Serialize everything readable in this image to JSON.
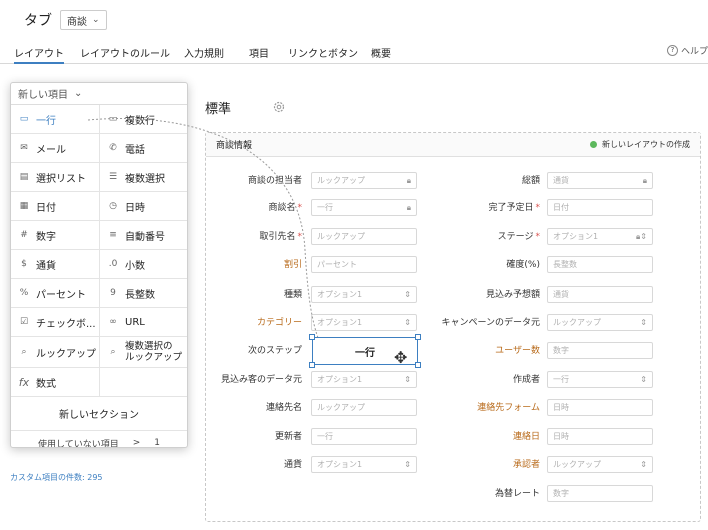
{
  "header": {
    "title": "タブ",
    "tab_value": "商談"
  },
  "nav": {
    "items": [
      "レイアウト",
      "レイアウトのルール",
      "入力規則",
      "項目",
      "リンクとボタン",
      "概要"
    ],
    "help": "ヘルプ"
  },
  "palette": {
    "title": "新しい項目",
    "items": [
      {
        "icon": "single-line-icon",
        "label": "一行"
      },
      {
        "icon": "multi-line-icon",
        "label": "複数行"
      },
      {
        "icon": "mail-icon",
        "label": "メール"
      },
      {
        "icon": "phone-icon",
        "label": "電話"
      },
      {
        "icon": "picklist-icon",
        "label": "選択リスト"
      },
      {
        "icon": "multi-select-icon",
        "label": "複数選択"
      },
      {
        "icon": "calendar-icon",
        "label": "日付"
      },
      {
        "icon": "datetime-icon",
        "label": "日時"
      },
      {
        "icon": "number-icon",
        "label": "数字"
      },
      {
        "icon": "autonumber-icon",
        "label": "自動番号"
      },
      {
        "icon": "currency-icon",
        "label": "通貨"
      },
      {
        "icon": "decimal-icon",
        "label": "小数"
      },
      {
        "icon": "percent-icon",
        "label": "パーセント"
      },
      {
        "icon": "long-integer-icon",
        "label": "長整数"
      },
      {
        "icon": "checkbox-icon",
        "label": "チェックボ..."
      },
      {
        "icon": "link-icon",
        "label": "URL"
      },
      {
        "icon": "lookup-icon",
        "label": "ルックアップ"
      },
      {
        "icon": "multi-lookup-icon",
        "label": "複数選択の\nルックアップ"
      },
      {
        "icon": "formula-icon",
        "label": "数式"
      }
    ],
    "new_section": "新しいセクション",
    "unused_label": "使用していない項目",
    "unused_arrow": ">",
    "unused_count": "1"
  },
  "custom_count": "カスタム項目の件数: 295",
  "layout": {
    "title": "標準",
    "section_title": "商談情報",
    "new_layout": "新しいレイアウトの作成",
    "drag_label": "一行",
    "left_fields": [
      {
        "label": "商談の担当者",
        "placeholder": "ルックアップ",
        "end": "lock"
      },
      {
        "label": "商談名",
        "required": true,
        "placeholder": "一行",
        "end": "lock"
      },
      {
        "label": "取引先名",
        "required": true,
        "placeholder": "ルックアップ",
        "end": ""
      },
      {
        "label": "割引",
        "orange": true,
        "placeholder": "パーセント",
        "end": ""
      },
      {
        "label": "種類",
        "placeholder": "オプション1",
        "end": "select"
      },
      {
        "label": "カテゴリー",
        "orange": true,
        "placeholder": "オプション1",
        "end": "select"
      },
      {
        "label": "次のステップ",
        "placeholder": "",
        "end": ""
      },
      {
        "label": "見込み客のデータ元",
        "placeholder": "オプション1",
        "end": "select"
      },
      {
        "label": "連絡先名",
        "placeholder": "ルックアップ",
        "end": ""
      },
      {
        "label": "更新者",
        "placeholder": "一行",
        "end": ""
      },
      {
        "label": "通貨",
        "placeholder": "オプション1",
        "end": "select"
      }
    ],
    "right_fields": [
      {
        "label": "総額",
        "placeholder": "通貨",
        "end": "lock"
      },
      {
        "label": "完了予定日",
        "required": true,
        "placeholder": "日付",
        "end": ""
      },
      {
        "label": "ステージ",
        "required": true,
        "placeholder": "オプション1",
        "end": "lockselect"
      },
      {
        "label": "確度(%)",
        "placeholder": "長整数",
        "end": ""
      },
      {
        "label": "見込み予想額",
        "placeholder": "通貨",
        "end": ""
      },
      {
        "label": "キャンペーンのデータ元",
        "placeholder": "ルックアップ",
        "end": "select"
      },
      {
        "label": "ユーザー数",
        "orange": true,
        "placeholder": "数字",
        "end": ""
      },
      {
        "label": "作成者",
        "placeholder": "一行",
        "end": "select"
      },
      {
        "label": "連絡先フォーム",
        "orange": true,
        "placeholder": "日時",
        "end": ""
      },
      {
        "label": "連絡日",
        "orange": true,
        "placeholder": "日時",
        "end": ""
      },
      {
        "label": "承認者",
        "orange": true,
        "placeholder": "ルックアップ",
        "end": "select"
      },
      {
        "label": "為替レート",
        "placeholder": "数字",
        "end": ""
      }
    ]
  }
}
